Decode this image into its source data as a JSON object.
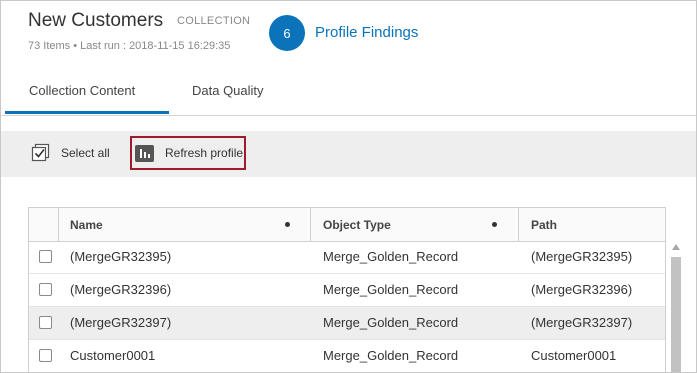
{
  "header": {
    "title": "New Customers",
    "type_tag": "COLLECTION",
    "meta": "73 Items • Last run : 2018-11-15 16:29:35",
    "findings_count": "6",
    "findings_label": "Profile Findings"
  },
  "tabs": [
    {
      "label": "Collection Content",
      "active": true
    },
    {
      "label": "Data Quality",
      "active": false
    }
  ],
  "toolbar": {
    "select_all_label": "Select all",
    "refresh_label": "Refresh profile"
  },
  "table": {
    "columns": [
      "Name",
      "Object Type",
      "Path"
    ],
    "rows": [
      {
        "name": "(MergeGR32395)",
        "type": "Merge_Golden_Record",
        "path": "(MergeGR32395)"
      },
      {
        "name": "(MergeGR32396)",
        "type": "Merge_Golden_Record",
        "path": "(MergeGR32396)"
      },
      {
        "name": "(MergeGR32397)",
        "type": "Merge_Golden_Record",
        "path": "(MergeGR32397)"
      },
      {
        "name": "Customer0001",
        "type": "Merge_Golden_Record",
        "path": "Customer0001"
      }
    ]
  },
  "colors": {
    "accent": "#0a73b9",
    "highlight_border": "#9b1d2d",
    "toolbar_bg": "#eeeeee"
  }
}
